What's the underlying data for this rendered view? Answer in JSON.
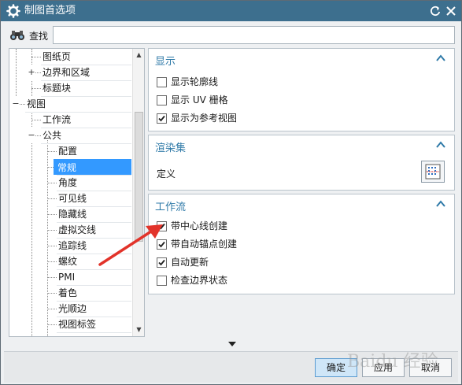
{
  "window": {
    "title": "制图首选项"
  },
  "search": {
    "label": "查找",
    "value": "",
    "placeholder": ""
  },
  "tree": {
    "items": [
      {
        "label": "图纸页"
      },
      {
        "label": "边界和区域",
        "toggle": "+"
      },
      {
        "label": "标题块"
      },
      {
        "label": "视图",
        "toggle": "−"
      },
      {
        "label": "工作流"
      },
      {
        "label": "公共",
        "toggle": "−"
      },
      {
        "label": "配置"
      },
      {
        "label": "常规",
        "selected": true
      },
      {
        "label": "角度"
      },
      {
        "label": "可见线"
      },
      {
        "label": "隐藏线"
      },
      {
        "label": "虚拟交线"
      },
      {
        "label": "追踪线"
      },
      {
        "label": "螺纹"
      },
      {
        "label": "PMI"
      },
      {
        "label": "着色"
      },
      {
        "label": "光顺边"
      },
      {
        "label": "视图标签"
      }
    ]
  },
  "panels": {
    "display": {
      "title": "显示",
      "options": [
        {
          "label": "显示轮廓线",
          "checked": false
        },
        {
          "label": "显示 UV 栅格",
          "checked": false
        },
        {
          "label": "显示为参考视图",
          "checked": true
        }
      ]
    },
    "render": {
      "title": "渲染集",
      "define_label": "定义"
    },
    "workflow": {
      "title": "工作流",
      "options": [
        {
          "label": "带中心线创建",
          "checked": true
        },
        {
          "label": "带自动锚点创建",
          "checked": true
        },
        {
          "label": "自动更新",
          "checked": true
        },
        {
          "label": "检查边界状态",
          "checked": false
        }
      ]
    }
  },
  "footer": {
    "ok": "确定",
    "apply": "应用",
    "cancel": "取消"
  },
  "watermark": "Baidu 经验",
  "colors": {
    "titlebar": "#3d6f8e",
    "accent": "#2f7aa8",
    "selection": "#3399ff",
    "annotation": "#e2332a"
  }
}
